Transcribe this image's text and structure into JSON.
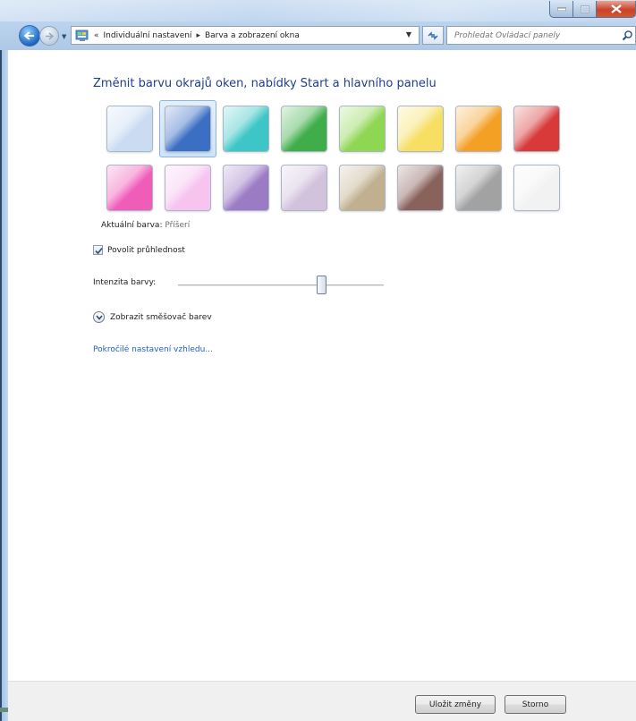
{
  "address": {
    "crumbs": [
      "Individuální nastavení",
      "Barva a zobrazení okna"
    ],
    "overflow": "«",
    "separator": "▸"
  },
  "search": {
    "placeholder": "Prohledat Ovládací panely"
  },
  "page": {
    "heading": "Změnit barvu okrajů oken, nabídky Start a hlavního panelu",
    "current_color_label": "Aktuální barva:",
    "current_color_value": "Příšerí",
    "transparency_label": "Povolit průhlednost",
    "transparency_checked": true,
    "intensity_label": "Intenzita barvy:",
    "intensity_level_fraction": 0.7,
    "mixer_label": "Zobrazit směšovač barev",
    "advanced_link": "Pokročilé nastavení vzhledu..."
  },
  "swatches": [
    {
      "name": "sky",
      "color": "#c9dcf2",
      "selected": false
    },
    {
      "name": "twilight",
      "color": "#3a6fc4",
      "selected": true
    },
    {
      "name": "sea",
      "color": "#3ec6c6",
      "selected": false
    },
    {
      "name": "leaf",
      "color": "#3fae4a",
      "selected": false
    },
    {
      "name": "lime",
      "color": "#8fd653",
      "selected": false
    },
    {
      "name": "lemon",
      "color": "#f6df63",
      "selected": false
    },
    {
      "name": "pumpkin",
      "color": "#f4a024",
      "selected": false
    },
    {
      "name": "ruby",
      "color": "#d83a3a",
      "selected": false
    },
    {
      "name": "fuchsia",
      "color": "#ef5db8",
      "selected": false
    },
    {
      "name": "blush",
      "color": "#f6c4ef",
      "selected": false
    },
    {
      "name": "violet",
      "color": "#9a7bc4",
      "selected": false
    },
    {
      "name": "lavender",
      "color": "#d2c2dc",
      "selected": false
    },
    {
      "name": "taupe",
      "color": "#c0b08f",
      "selected": false
    },
    {
      "name": "chocolate",
      "color": "#8a625c",
      "selected": false
    },
    {
      "name": "slate",
      "color": "#a2a2a2",
      "selected": false
    },
    {
      "name": "frost",
      "color": "#f2f2f2",
      "selected": false
    }
  ],
  "buttons": {
    "save": "Uložit změny",
    "cancel": "Storno"
  }
}
